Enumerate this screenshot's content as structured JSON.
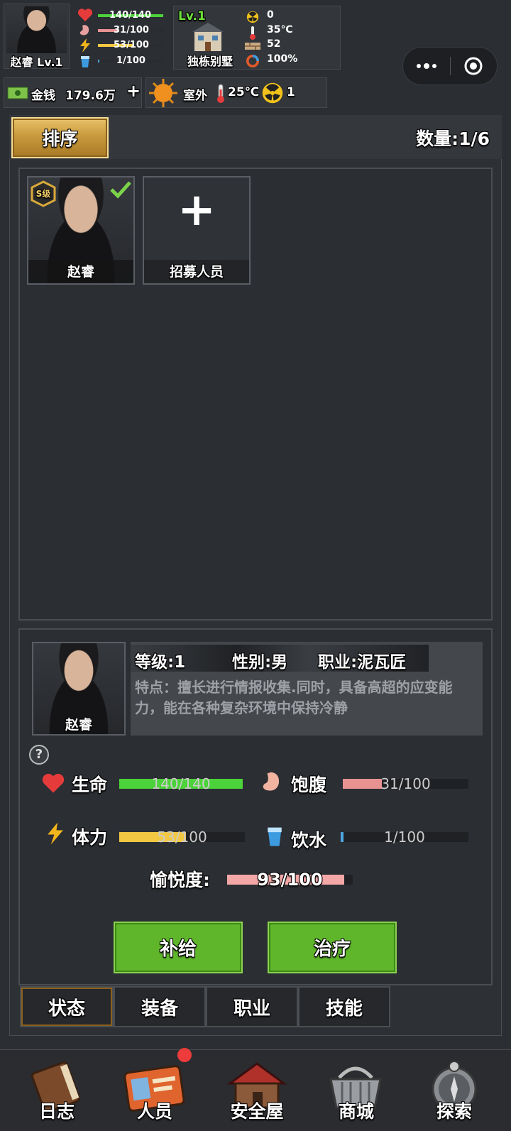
{
  "player": {
    "name_level": "赵睿 Lv.1",
    "hp": "140/140",
    "hp_frac": 1.0,
    "food": "31/100",
    "food_frac": 0.31,
    "energy": "53/100",
    "energy_frac": 0.53,
    "water": "1/100",
    "water_frac": 0.01
  },
  "shelter": {
    "level": "Lv.1",
    "name": "独栋别墅",
    "radiation": "0",
    "temperature": "35℃",
    "defense": "52",
    "durability": "100%"
  },
  "resources": {
    "money_label": "金钱",
    "money_value": "179.6万",
    "plus": "+",
    "location": "室外",
    "outside_temp": "25℃",
    "outside_radiation": "1"
  },
  "roster": {
    "sort_label": "排序",
    "count_label": "数量:1/6",
    "cards": [
      {
        "name": "赵睿",
        "grade": "S级"
      },
      {
        "name": "招募人员",
        "symbol": "+"
      }
    ]
  },
  "detail": {
    "name": "赵睿",
    "level": "等级:1",
    "gender": "性别:男",
    "job": "职业:泥瓦匠",
    "trait": "特点：擅长进行情报收集.同时，具备高超的应变能力，能在各种复杂环境中保持冷静",
    "help": "?",
    "stats": {
      "hp_label": "生命",
      "hp_value": "140/140",
      "hp_frac": 1.0,
      "food_label": "饱腹",
      "food_value": "31/100",
      "food_frac": 0.31,
      "energy_label": "体力",
      "energy_value": "53/100",
      "energy_frac": 0.53,
      "water_label": "饮水",
      "water_value": "1/100",
      "water_frac": 0.01,
      "mood_label": "愉悦度:",
      "mood_value": "93/100",
      "mood_frac": 0.93
    },
    "buttons": {
      "supply": "补给",
      "heal": "治疗"
    },
    "tabs": [
      "状态",
      "装备",
      "职业",
      "技能"
    ]
  },
  "nav": [
    "日志",
    "人员",
    "安全屋",
    "商城",
    "探索"
  ],
  "colors": {
    "hp": "#4cd23a",
    "food": "#e89292",
    "energy": "#f2c843",
    "water": "#4ea6e0",
    "mood": "#f4a7a7",
    "gold": "#c99a3d",
    "green_btn": "#5fb62b"
  }
}
